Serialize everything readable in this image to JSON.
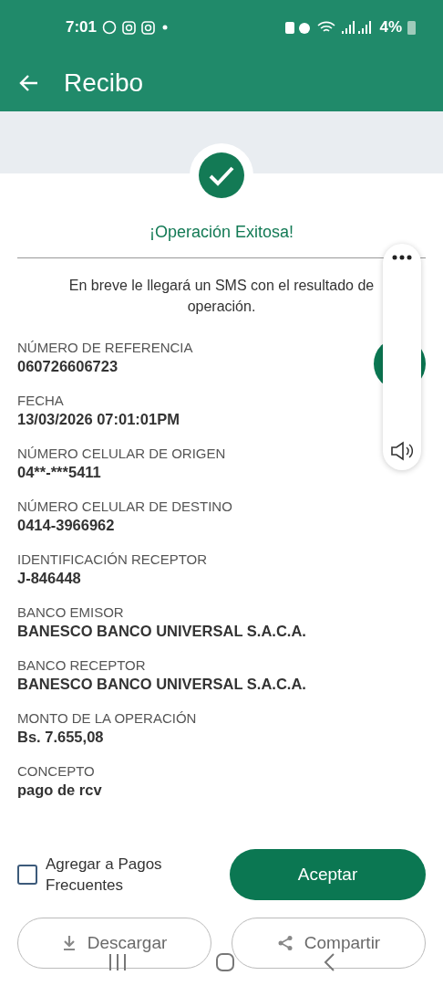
{
  "status_bar": {
    "time": "7:01",
    "battery": "4%"
  },
  "app_bar": {
    "title": "Recibo"
  },
  "result": {
    "title": "¡Operación Exitosa!",
    "message_lines": [
      "En breve le llegará un SMS con el resultado de",
      "operación."
    ]
  },
  "fields": [
    {
      "label": "NÚMERO DE REFERENCIA",
      "value": "060726606723"
    },
    {
      "label": "FECHA",
      "value": "13/03/2026 07:01:01PM"
    },
    {
      "label": "NÚMERO CELULAR DE ORIGEN",
      "value": "04**-***5411"
    },
    {
      "label": "NÚMERO CELULAR DE DESTINO",
      "value": "0414-3966962"
    },
    {
      "label": "IDENTIFICACIÓN RECEPTOR",
      "value": "J-846448"
    },
    {
      "label": "BANCO EMISOR",
      "value": "BANESCO BANCO UNIVERSAL S.A.C.A."
    },
    {
      "label": "BANCO RECEPTOR",
      "value": "BANESCO BANCO UNIVERSAL S.A.C.A."
    },
    {
      "label": "MONTO DE LA OPERACIÓN",
      "value": "Bs. 7.655,08"
    },
    {
      "label": "CONCEPTO",
      "value": "pago de rcv"
    }
  ],
  "frequent_payment": {
    "label": "Agregar a Pagos Frecuentes",
    "checked": false
  },
  "accept_button": "Aceptar",
  "secondary_buttons": [
    {
      "kind": "download",
      "label": "Descargar"
    },
    {
      "kind": "share",
      "label": "Compartir"
    }
  ]
}
